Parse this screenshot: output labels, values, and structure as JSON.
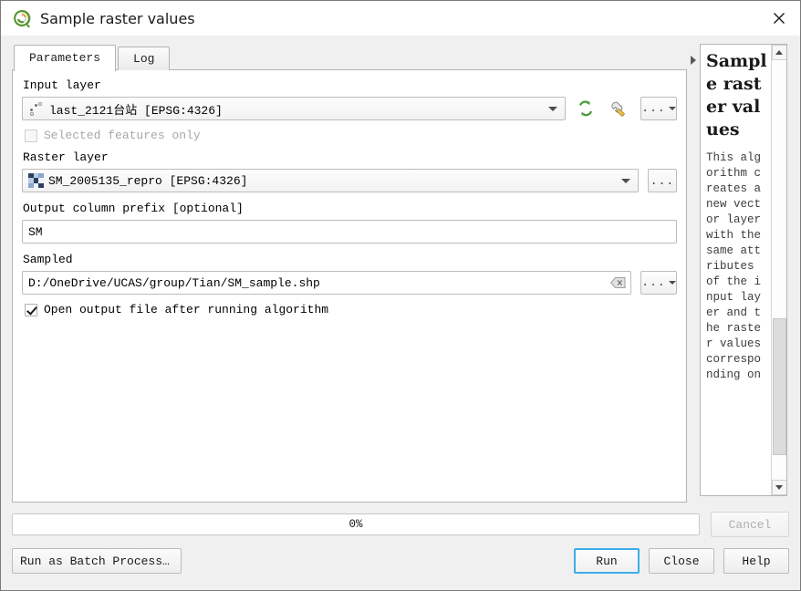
{
  "window": {
    "title": "Sample raster values",
    "app_icon": "qgis-logo-icon",
    "close_icon": "close-icon"
  },
  "tabs": [
    {
      "label": "Parameters",
      "active": true
    },
    {
      "label": "Log",
      "active": false
    }
  ],
  "parameters": {
    "input_layer": {
      "label": "Input layer",
      "value": "last_2121台站 [EPSG:4326]",
      "icon": "point-vector-layer-icon",
      "iterate_icon": "iterate-refresh-icon",
      "tool_icon": "wrench-icon",
      "more_button": "..."
    },
    "selected_features": {
      "label": "Selected features only",
      "checked": false,
      "enabled": false
    },
    "raster_layer": {
      "label": "Raster layer",
      "value": "SM_2005135_repro [EPSG:4326]",
      "icon": "raster-layer-icon",
      "more_button": "..."
    },
    "output_prefix": {
      "label": "Output column prefix [optional]",
      "value": "SM"
    },
    "sampled": {
      "label": "Sampled",
      "value": "D:/OneDrive/UCAS/group/Tian/SM_sample.shp",
      "clear_icon": "clear-backspace-icon",
      "more_button": "..."
    },
    "open_output": {
      "label": "Open output file after running algorithm",
      "checked": true
    }
  },
  "help": {
    "title": "Sample raster values",
    "body": "This algorithm creates a new vector layer with the same attributes of the input layer and the raster values corresponding on",
    "scroll_up_icon": "scroll-up-arrow-icon",
    "scroll_down_icon": "scroll-down-arrow-icon"
  },
  "splitter": {
    "collapse_icon": "collapse-right-arrow-icon"
  },
  "footer": {
    "progress_text": "0%",
    "progress_percent": 0,
    "cancel_label": "Cancel",
    "batch_label": "Run as Batch Process…",
    "run_label": "Run",
    "close_label": "Close",
    "help_label": "Help"
  },
  "colors": {
    "accent_focus": "#3daee9",
    "qgis_green": "#589632",
    "window_bg": "#f0f0f0",
    "panel_bg": "#ffffff"
  }
}
